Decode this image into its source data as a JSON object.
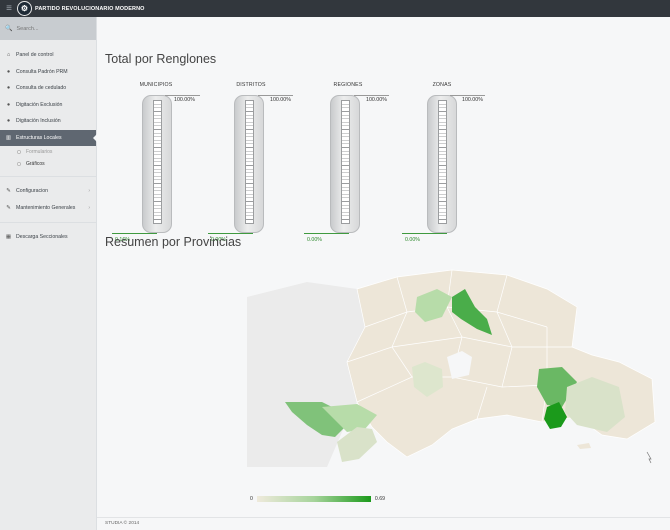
{
  "app": {
    "menu_icon": "hamburger-icon",
    "logo_glyph": "⚙",
    "brand": "PARTIDO REVOLUCIONARIO MODERNO"
  },
  "search": {
    "placeholder": "Search..."
  },
  "sidebar": {
    "items": [
      {
        "label": "Panel de control",
        "icon": "home-icon"
      },
      {
        "label": "Consulta Padrón PRM",
        "icon": "user-icon"
      },
      {
        "label": "Consulta de cedulado",
        "icon": "user-icon"
      },
      {
        "label": "Digitación Exclusión",
        "icon": "user-icon"
      },
      {
        "label": "Digitación Inclusión",
        "icon": "user-icon"
      },
      {
        "label": "Estructuras Locales",
        "icon": "bar-chart-icon",
        "active": true
      }
    ],
    "subitems": [
      {
        "label": "Formularios"
      },
      {
        "label": "Gráficos",
        "current": true
      }
    ],
    "items2": [
      {
        "label": "Configuracion",
        "icon": "wrench-icon"
      },
      {
        "label": "Mantenimiento Generales",
        "icon": "wrench-icon"
      }
    ],
    "items3": [
      {
        "label": "Descarga Seccionales",
        "icon": "table-icon"
      }
    ]
  },
  "main": {
    "title1": "Total por Renglones",
    "gauges": [
      {
        "label": "MUNICIPIOS",
        "max_label": "100.00%",
        "value_label": "0.16%",
        "value": 0.16
      },
      {
        "label": "DISTRITOS",
        "max_label": "100.00%",
        "value_label": "0.00%",
        "value": 0
      },
      {
        "label": "REGIONES",
        "max_label": "100.00%",
        "value_label": "0.00%",
        "value": 0
      },
      {
        "label": "ZONAS",
        "max_label": "100.00%",
        "value_label": "0.00%",
        "value": 0
      }
    ],
    "title2": "Resumen por Provincias",
    "legend": {
      "min": "0",
      "max": "0.69"
    }
  },
  "colors": {
    "low": "#efeadc",
    "mid": "#a6d49b",
    "high": "#1b9a1b",
    "active_nav": "#5f6771"
  },
  "footer": {
    "text": "STUDIA © 2014"
  }
}
